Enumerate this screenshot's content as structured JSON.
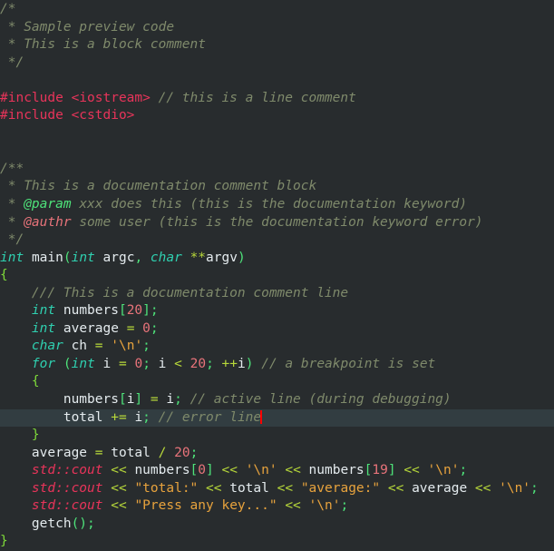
{
  "editor": {
    "language": "C++",
    "theme_name": "dark-code-preview",
    "colors": {
      "background": "#282c2e",
      "current_line_background": "#323d41",
      "comment": "#7f8a6b",
      "doc_keyword": "#4ee37a",
      "doc_keyword_error": "#e8737a",
      "preprocessor": "#e8345a",
      "keyword": "#2fd0b0",
      "identifier": "#e4ebee",
      "number": "#e8737a",
      "string": "#e8a33d",
      "operator": "#b8d93a",
      "punctuation": "#4ee37a",
      "std_namespace": "#e8345a",
      "cursor": "#ff0000"
    },
    "cursor": {
      "line_index": 20,
      "visible": true
    },
    "lines": [
      {
        "id": 1,
        "highlight": false,
        "tokens": [
          {
            "text": "/*",
            "type": "cmt"
          }
        ]
      },
      {
        "id": 2,
        "highlight": false,
        "tokens": [
          {
            "text": " * Sample preview code",
            "type": "cmt"
          }
        ]
      },
      {
        "id": 3,
        "highlight": false,
        "tokens": [
          {
            "text": " * This is a block comment",
            "type": "cmt"
          }
        ]
      },
      {
        "id": 4,
        "highlight": false,
        "tokens": [
          {
            "text": " */",
            "type": "cmt"
          }
        ]
      },
      {
        "id": 5,
        "highlight": false,
        "tokens": []
      },
      {
        "id": 6,
        "highlight": false,
        "tokens": [
          {
            "text": "#include <iostream>",
            "type": "pre"
          },
          {
            "text": " ",
            "type": "plain"
          },
          {
            "text": "// this is a line comment",
            "type": "cmt"
          }
        ]
      },
      {
        "id": 7,
        "highlight": false,
        "tokens": [
          {
            "text": "#include <cstdio>",
            "type": "pre"
          }
        ]
      },
      {
        "id": 8,
        "highlight": false,
        "tokens": []
      },
      {
        "id": 9,
        "highlight": false,
        "tokens": []
      },
      {
        "id": 10,
        "highlight": false,
        "tokens": [
          {
            "text": "/**",
            "type": "doc"
          }
        ]
      },
      {
        "id": 11,
        "highlight": false,
        "tokens": [
          {
            "text": " * This is a documentation comment block",
            "type": "doc"
          }
        ]
      },
      {
        "id": 12,
        "highlight": false,
        "tokens": [
          {
            "text": " * ",
            "type": "doc"
          },
          {
            "text": "@param",
            "type": "dockw"
          },
          {
            "text": " xxx does this (this is the documentation keyword)",
            "type": "doc"
          }
        ]
      },
      {
        "id": 13,
        "highlight": false,
        "tokens": [
          {
            "text": " * ",
            "type": "doc"
          },
          {
            "text": "@authr",
            "type": "dockwerr"
          },
          {
            "text": " some user (this is the documentation keyword error)",
            "type": "doc"
          }
        ]
      },
      {
        "id": 14,
        "highlight": false,
        "tokens": [
          {
            "text": " */",
            "type": "doc"
          }
        ]
      },
      {
        "id": 15,
        "highlight": false,
        "tokens": [
          {
            "text": "int",
            "type": "kw"
          },
          {
            "text": " ",
            "type": "plain"
          },
          {
            "text": "main",
            "type": "ident"
          },
          {
            "text": "(",
            "type": "punc"
          },
          {
            "text": "int",
            "type": "kw"
          },
          {
            "text": " ",
            "type": "plain"
          },
          {
            "text": "argc",
            "type": "ident"
          },
          {
            "text": ",",
            "type": "punc"
          },
          {
            "text": " ",
            "type": "plain"
          },
          {
            "text": "char",
            "type": "kw"
          },
          {
            "text": " ",
            "type": "plain"
          },
          {
            "text": "**",
            "type": "op"
          },
          {
            "text": "argv",
            "type": "ident"
          },
          {
            "text": ")",
            "type": "punc"
          }
        ]
      },
      {
        "id": 16,
        "highlight": false,
        "tokens": [
          {
            "text": "{",
            "type": "brace"
          }
        ]
      },
      {
        "id": 17,
        "highlight": false,
        "tokens": [
          {
            "text": "    ",
            "type": "plain"
          },
          {
            "text": "/// This is a documentation comment line",
            "type": "doc"
          }
        ]
      },
      {
        "id": 18,
        "highlight": false,
        "tokens": [
          {
            "text": "    ",
            "type": "plain"
          },
          {
            "text": "int",
            "type": "kw"
          },
          {
            "text": " ",
            "type": "plain"
          },
          {
            "text": "numbers",
            "type": "ident"
          },
          {
            "text": "[",
            "type": "punc"
          },
          {
            "text": "20",
            "type": "num"
          },
          {
            "text": "];",
            "type": "punc"
          }
        ]
      },
      {
        "id": 19,
        "highlight": false,
        "tokens": [
          {
            "text": "    ",
            "type": "plain"
          },
          {
            "text": "int",
            "type": "kw"
          },
          {
            "text": " ",
            "type": "plain"
          },
          {
            "text": "average",
            "type": "ident"
          },
          {
            "text": " ",
            "type": "plain"
          },
          {
            "text": "=",
            "type": "op"
          },
          {
            "text": " ",
            "type": "plain"
          },
          {
            "text": "0",
            "type": "num"
          },
          {
            "text": ";",
            "type": "punc"
          }
        ]
      },
      {
        "id": 20,
        "highlight": false,
        "tokens": [
          {
            "text": "    ",
            "type": "plain"
          },
          {
            "text": "char",
            "type": "kw"
          },
          {
            "text": " ",
            "type": "plain"
          },
          {
            "text": "ch",
            "type": "ident"
          },
          {
            "text": " ",
            "type": "plain"
          },
          {
            "text": "=",
            "type": "op"
          },
          {
            "text": " ",
            "type": "plain"
          },
          {
            "text": "'\\n'",
            "type": "str"
          },
          {
            "text": ";",
            "type": "punc"
          }
        ]
      },
      {
        "id": 21,
        "highlight": false,
        "tokens": [
          {
            "text": "    ",
            "type": "plain"
          },
          {
            "text": "for",
            "type": "kw"
          },
          {
            "text": " ",
            "type": "plain"
          },
          {
            "text": "(",
            "type": "punc"
          },
          {
            "text": "int",
            "type": "kw"
          },
          {
            "text": " ",
            "type": "plain"
          },
          {
            "text": "i",
            "type": "ident"
          },
          {
            "text": " ",
            "type": "plain"
          },
          {
            "text": "=",
            "type": "op"
          },
          {
            "text": " ",
            "type": "plain"
          },
          {
            "text": "0",
            "type": "num"
          },
          {
            "text": ";",
            "type": "punc"
          },
          {
            "text": " ",
            "type": "plain"
          },
          {
            "text": "i",
            "type": "ident"
          },
          {
            "text": " ",
            "type": "plain"
          },
          {
            "text": "<",
            "type": "op"
          },
          {
            "text": " ",
            "type": "plain"
          },
          {
            "text": "20",
            "type": "num"
          },
          {
            "text": ";",
            "type": "punc"
          },
          {
            "text": " ",
            "type": "plain"
          },
          {
            "text": "++",
            "type": "op"
          },
          {
            "text": "i",
            "type": "ident"
          },
          {
            "text": ")",
            "type": "punc"
          },
          {
            "text": " ",
            "type": "plain"
          },
          {
            "text": "// a breakpoint is set",
            "type": "cmt"
          }
        ]
      },
      {
        "id": 22,
        "highlight": false,
        "tokens": [
          {
            "text": "    ",
            "type": "plain"
          },
          {
            "text": "{",
            "type": "brace"
          }
        ]
      },
      {
        "id": 23,
        "highlight": false,
        "tokens": [
          {
            "text": "        ",
            "type": "plain"
          },
          {
            "text": "numbers",
            "type": "ident"
          },
          {
            "text": "[",
            "type": "punc"
          },
          {
            "text": "i",
            "type": "ident"
          },
          {
            "text": "]",
            "type": "punc"
          },
          {
            "text": " ",
            "type": "plain"
          },
          {
            "text": "=",
            "type": "op"
          },
          {
            "text": " ",
            "type": "plain"
          },
          {
            "text": "i",
            "type": "ident"
          },
          {
            "text": ";",
            "type": "punc"
          },
          {
            "text": " ",
            "type": "plain"
          },
          {
            "text": "// active line (during debugging)",
            "type": "cmt"
          }
        ]
      },
      {
        "id": 24,
        "highlight": true,
        "tokens": [
          {
            "text": "        ",
            "type": "plain"
          },
          {
            "text": "total",
            "type": "ident"
          },
          {
            "text": " ",
            "type": "plain"
          },
          {
            "text": "+=",
            "type": "op"
          },
          {
            "text": " ",
            "type": "plain"
          },
          {
            "text": "i",
            "type": "ident"
          },
          {
            "text": ";",
            "type": "punc"
          },
          {
            "text": " ",
            "type": "plain"
          },
          {
            "text": "// error line",
            "type": "cmt"
          },
          {
            "text": "",
            "type": "cursor"
          }
        ]
      },
      {
        "id": 25,
        "highlight": false,
        "tokens": [
          {
            "text": "    ",
            "type": "plain"
          },
          {
            "text": "}",
            "type": "brace"
          }
        ]
      },
      {
        "id": 26,
        "highlight": false,
        "tokens": [
          {
            "text": "    ",
            "type": "plain"
          },
          {
            "text": "average",
            "type": "ident"
          },
          {
            "text": " ",
            "type": "plain"
          },
          {
            "text": "=",
            "type": "op"
          },
          {
            "text": " ",
            "type": "plain"
          },
          {
            "text": "total",
            "type": "ident"
          },
          {
            "text": " ",
            "type": "plain"
          },
          {
            "text": "/",
            "type": "op"
          },
          {
            "text": " ",
            "type": "plain"
          },
          {
            "text": "20",
            "type": "num"
          },
          {
            "text": ";",
            "type": "punc"
          }
        ]
      },
      {
        "id": 27,
        "highlight": false,
        "tokens": [
          {
            "text": "    ",
            "type": "plain"
          },
          {
            "text": "std::cout",
            "type": "std"
          },
          {
            "text": " ",
            "type": "plain"
          },
          {
            "text": "<<",
            "type": "op"
          },
          {
            "text": " ",
            "type": "plain"
          },
          {
            "text": "numbers",
            "type": "ident"
          },
          {
            "text": "[",
            "type": "punc"
          },
          {
            "text": "0",
            "type": "num"
          },
          {
            "text": "]",
            "type": "punc"
          },
          {
            "text": " ",
            "type": "plain"
          },
          {
            "text": "<<",
            "type": "op"
          },
          {
            "text": " ",
            "type": "plain"
          },
          {
            "text": "'\\n'",
            "type": "str"
          },
          {
            "text": " ",
            "type": "plain"
          },
          {
            "text": "<<",
            "type": "op"
          },
          {
            "text": " ",
            "type": "plain"
          },
          {
            "text": "numbers",
            "type": "ident"
          },
          {
            "text": "[",
            "type": "punc"
          },
          {
            "text": "19",
            "type": "num"
          },
          {
            "text": "]",
            "type": "punc"
          },
          {
            "text": " ",
            "type": "plain"
          },
          {
            "text": "<<",
            "type": "op"
          },
          {
            "text": " ",
            "type": "plain"
          },
          {
            "text": "'\\n'",
            "type": "str"
          },
          {
            "text": ";",
            "type": "punc"
          }
        ]
      },
      {
        "id": 28,
        "highlight": false,
        "tokens": [
          {
            "text": "    ",
            "type": "plain"
          },
          {
            "text": "std::cout",
            "type": "std"
          },
          {
            "text": " ",
            "type": "plain"
          },
          {
            "text": "<<",
            "type": "op"
          },
          {
            "text": " ",
            "type": "plain"
          },
          {
            "text": "\"total:\"",
            "type": "str"
          },
          {
            "text": " ",
            "type": "plain"
          },
          {
            "text": "<<",
            "type": "op"
          },
          {
            "text": " ",
            "type": "plain"
          },
          {
            "text": "total",
            "type": "ident"
          },
          {
            "text": " ",
            "type": "plain"
          },
          {
            "text": "<<",
            "type": "op"
          },
          {
            "text": " ",
            "type": "plain"
          },
          {
            "text": "\"average:\"",
            "type": "str"
          },
          {
            "text": " ",
            "type": "plain"
          },
          {
            "text": "<<",
            "type": "op"
          },
          {
            "text": " ",
            "type": "plain"
          },
          {
            "text": "average",
            "type": "ident"
          },
          {
            "text": " ",
            "type": "plain"
          },
          {
            "text": "<<",
            "type": "op"
          },
          {
            "text": " ",
            "type": "plain"
          },
          {
            "text": "'\\n'",
            "type": "str"
          },
          {
            "text": ";",
            "type": "punc"
          }
        ]
      },
      {
        "id": 29,
        "highlight": false,
        "tokens": [
          {
            "text": "    ",
            "type": "plain"
          },
          {
            "text": "std::cout",
            "type": "std"
          },
          {
            "text": " ",
            "type": "plain"
          },
          {
            "text": "<<",
            "type": "op"
          },
          {
            "text": " ",
            "type": "plain"
          },
          {
            "text": "\"Press any key...\"",
            "type": "str"
          },
          {
            "text": " ",
            "type": "plain"
          },
          {
            "text": "<<",
            "type": "op"
          },
          {
            "text": " ",
            "type": "plain"
          },
          {
            "text": "'\\n'",
            "type": "str"
          },
          {
            "text": ";",
            "type": "punc"
          }
        ]
      },
      {
        "id": 30,
        "highlight": false,
        "tokens": [
          {
            "text": "    ",
            "type": "plain"
          },
          {
            "text": "getch",
            "type": "ident"
          },
          {
            "text": "();",
            "type": "punc"
          }
        ]
      },
      {
        "id": 31,
        "highlight": false,
        "tokens": [
          {
            "text": "}",
            "type": "brace"
          }
        ]
      }
    ]
  }
}
